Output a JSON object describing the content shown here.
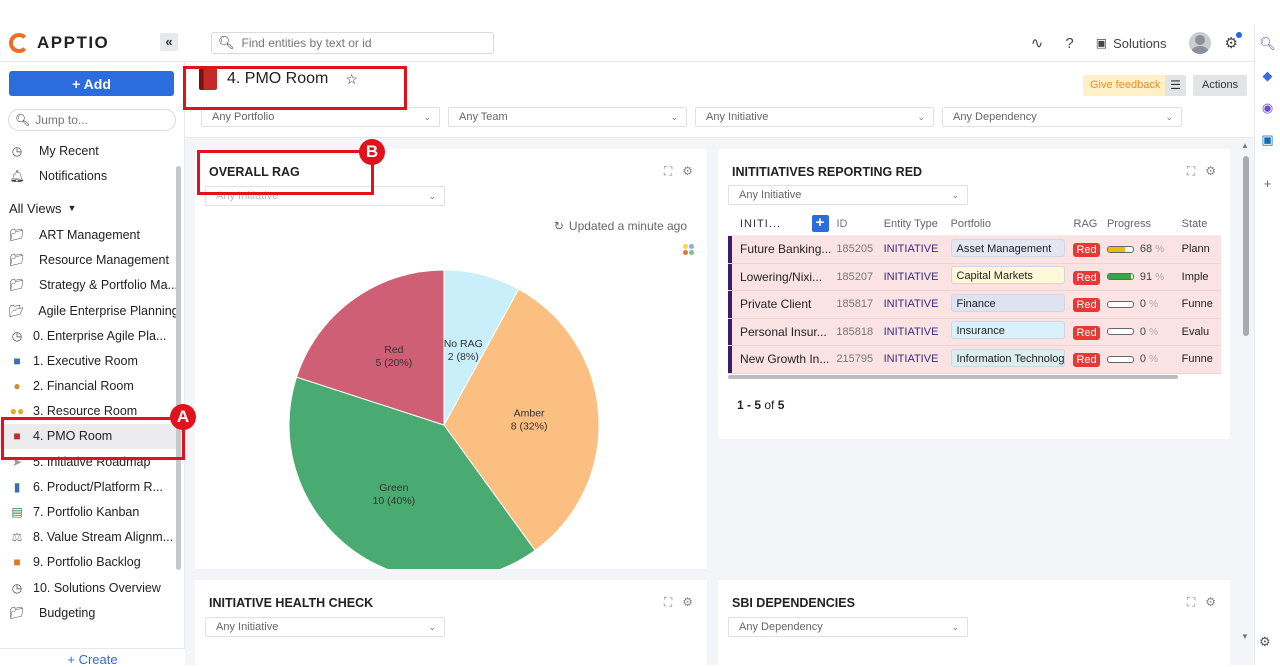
{
  "header": {
    "brand": "APPTIO",
    "collapse_icon": "«",
    "search_placeholder": "Find entities by text or id",
    "solutions_label": "Solutions",
    "icons": [
      "trend-icon",
      "help-icon",
      "cube-icon",
      "avatar",
      "sliders-icon"
    ]
  },
  "sidebar": {
    "add_label": "+ Add",
    "jump_placeholder": "Jump to...",
    "top_items": [
      {
        "label": "My Recent",
        "icon": "clock-icon"
      },
      {
        "label": "Notifications",
        "icon": "bell-icon"
      }
    ],
    "section_label": "All Views",
    "items": [
      {
        "label": "ART Management",
        "icon": "folder-icon"
      },
      {
        "label": "Resource Management",
        "icon": "folder-icon"
      },
      {
        "label": "Strategy & Portfolio Ma...",
        "icon": "folder-icon"
      },
      {
        "label": "Agile Enterprise Planning",
        "icon": "folder-open-icon"
      },
      {
        "label": "0. Enterprise Agile Pla...",
        "icon": "dashboard-icon"
      },
      {
        "label": "1. Executive Room",
        "icon": "executive-icon"
      },
      {
        "label": "2. Financial Room",
        "icon": "money-bag-icon"
      },
      {
        "label": "3. Resource Room",
        "icon": "people-icon"
      },
      {
        "label": "4. PMO Room",
        "icon": "book-icon",
        "active": true
      },
      {
        "label": "5. Initiative Roadmap",
        "icon": "roadmap-icon"
      },
      {
        "label": "6. Product/Platform R...",
        "icon": "bar-chart-icon"
      },
      {
        "label": "7. Portfolio Kanban",
        "icon": "books-icon"
      },
      {
        "label": "8. Value Stream Alignm...",
        "icon": "scales-icon"
      },
      {
        "label": "9. Portfolio Backlog",
        "icon": "notebook-icon"
      },
      {
        "label": "10. Solutions Overview",
        "icon": "dashboard-icon"
      },
      {
        "label": "Budgeting",
        "icon": "folder-icon"
      }
    ],
    "create_label": "+ Create"
  },
  "page": {
    "title": "4. PMO Room",
    "feedback_label": "Give feedback",
    "actions_label": "Actions",
    "filters": [
      "Any Portfolio",
      "Any Team",
      "Any Initiative",
      "Any Dependency"
    ]
  },
  "widgets": {
    "overall_rag": {
      "title": "OVERALL RAG",
      "filter": "Any Initiative",
      "updated": "Updated a minute ago"
    },
    "reporting_red": {
      "title": "INITITIATIVES REPORTING RED",
      "filter": "Any Initiative",
      "columns": [
        "INITI...",
        "ID",
        "Entity Type",
        "Portfolio",
        "RAG",
        "Progress",
        "State"
      ],
      "rows": [
        {
          "name": "Future Banking...",
          "id": "185205",
          "type": "INITIATIVE",
          "portfolio": "Asset Management",
          "portfolio_color": "#e4e6f1",
          "rag": "Red",
          "progress": 68,
          "bar_color": "#f2b90c",
          "state": "Plann"
        },
        {
          "name": "Lowering/Nixi...",
          "id": "185207",
          "type": "INITIATIVE",
          "portfolio": "Capital Markets",
          "portfolio_color": "#fdf8d6",
          "rag": "Red",
          "progress": 91,
          "bar_color": "#3aa346",
          "state": "Imple"
        },
        {
          "name": "Private Client",
          "id": "185817",
          "type": "INITIATIVE",
          "portfolio": "Finance",
          "portfolio_color": "#dfe3f1",
          "rag": "Red",
          "progress": 0,
          "bar_color": "#3aa346",
          "state": "Funne"
        },
        {
          "name": "Personal Insur...",
          "id": "185818",
          "type": "INITIATIVE",
          "portfolio": "Insurance",
          "portfolio_color": "#d8f1fa",
          "rag": "Red",
          "progress": 0,
          "bar_color": "#3aa346",
          "state": "Evalu"
        },
        {
          "name": "New Growth In...",
          "id": "215795",
          "type": "INITIATIVE",
          "portfolio": "Information Technology",
          "portfolio_color": "#dcefef",
          "rag": "Red",
          "progress": 0,
          "bar_color": "#3aa346",
          "state": "Funne"
        }
      ],
      "pager_range": "1 - 5",
      "pager_of": "of",
      "pager_total": "5"
    },
    "health_check": {
      "title": "INITIATIVE HEALTH CHECK",
      "filter": "Any Initiative"
    },
    "sbi_dependencies": {
      "title": "SBI DEPENDENCIES",
      "filter": "Any Dependency"
    }
  },
  "chart_data": {
    "type": "pie",
    "title": "OVERALL RAG",
    "categories": [
      "No RAG",
      "Amber",
      "Green",
      "Red"
    ],
    "values": [
      2,
      8,
      10,
      5
    ],
    "percentages": [
      8,
      32,
      40,
      20
    ],
    "colors": [
      "#c8effa",
      "#fbbf82",
      "#4aab72",
      "#cf5f75"
    ],
    "labels": [
      "2 (8%)",
      "8 (32%)",
      "10 (40%)",
      "5 (20%)"
    ],
    "start": "top, clockwise"
  },
  "callouts": {
    "a": "A",
    "b": "B"
  }
}
